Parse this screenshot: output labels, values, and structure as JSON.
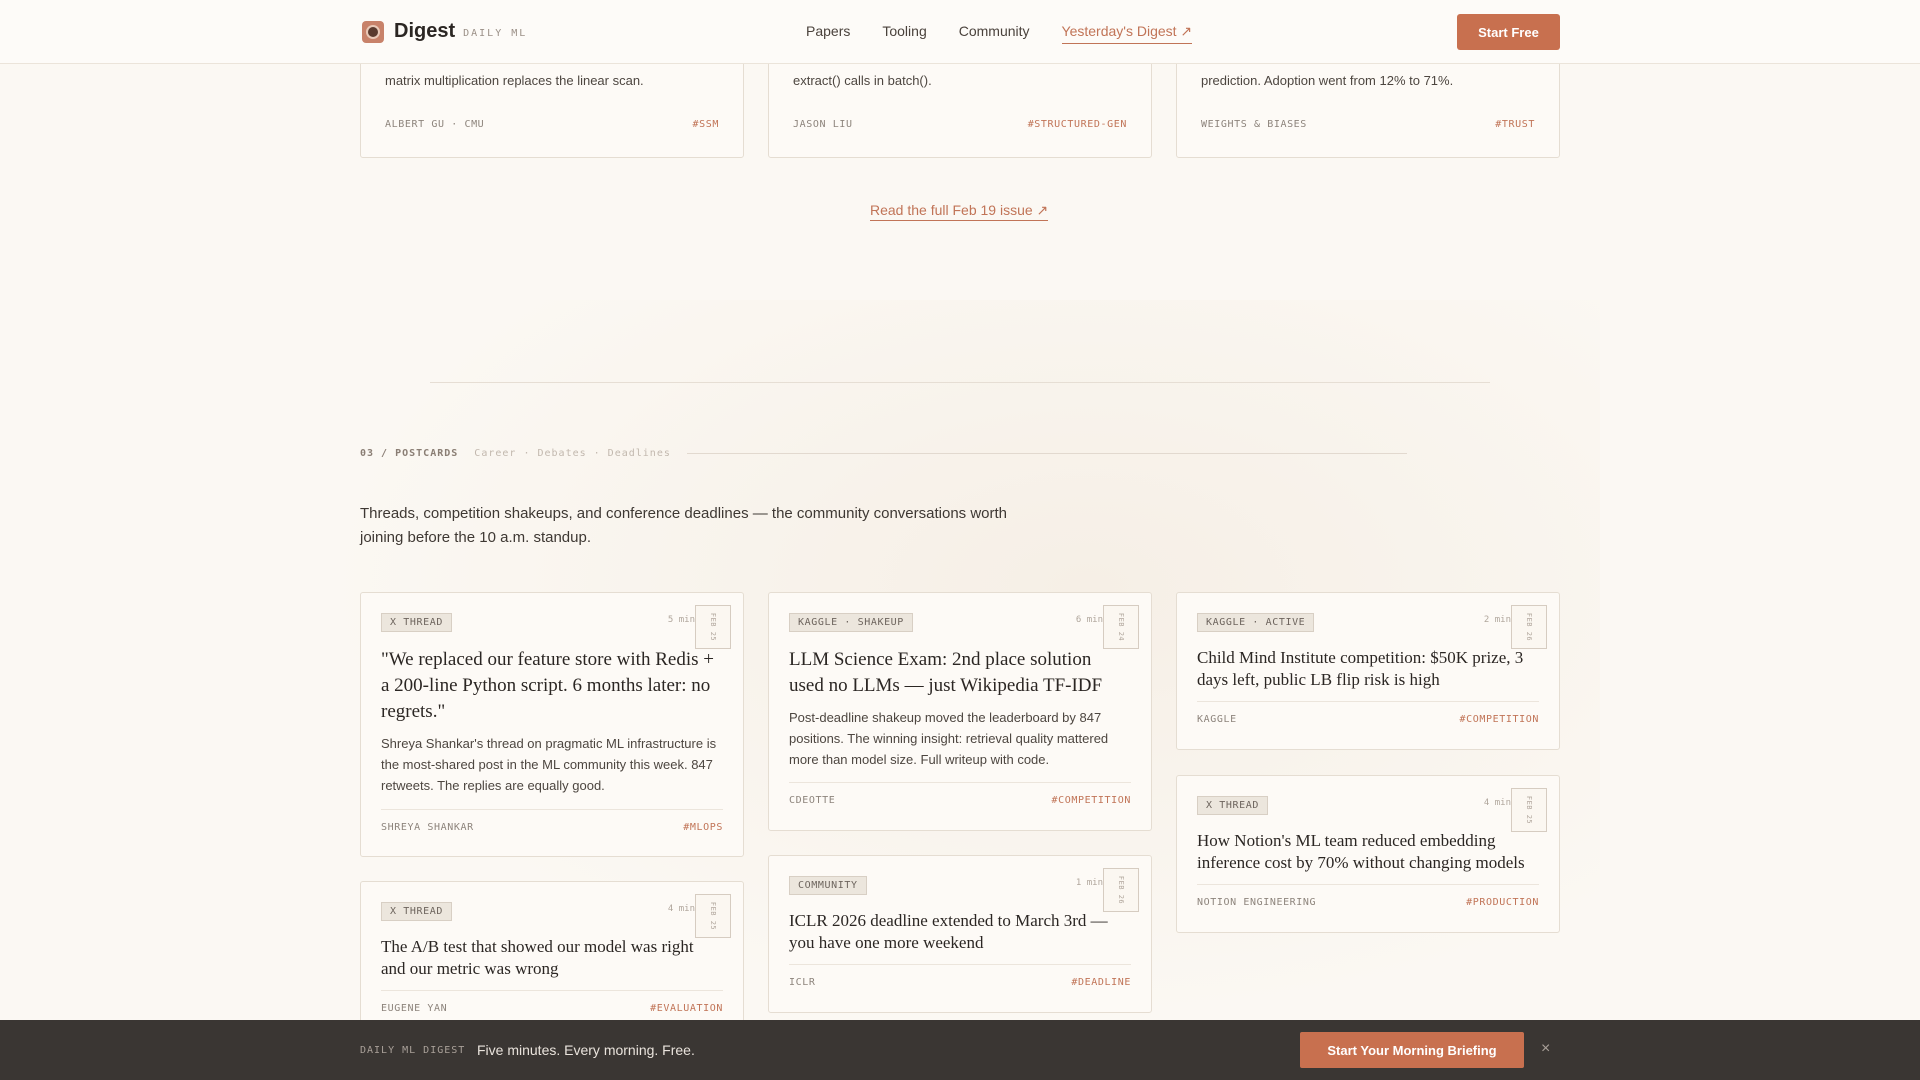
{
  "header": {
    "brand": "Digest",
    "brand_sub": "DAILY ML",
    "nav": [
      "Papers",
      "Tooling",
      "Community",
      "Yesterday's Digest ↗"
    ],
    "cta": "Start Free"
  },
  "top_cards": [
    {
      "excerpt": "matrix multiplication replaces the linear scan.",
      "author": "ALBERT GU · CMU",
      "tag": "#SSM"
    },
    {
      "excerpt": "extract() calls in batch().",
      "author": "JASON LIU",
      "tag": "#STRUCTURED-GEN"
    },
    {
      "excerpt": "prediction. Adoption went from 12% to 71%.",
      "author": "WEIGHTS & BIASES",
      "tag": "#TRUST"
    }
  ],
  "read_more": "Read the full Feb 19 issue ↗",
  "section": {
    "number": "03 / POSTCARDS",
    "topics": "Career · Debates · Deadlines",
    "intro": "Threads, competition shakeups, and conference deadlines — the community conversations worth joining before the 10 a.m. standup."
  },
  "postcards": [
    {
      "badge": "X THREAD",
      "min": "5 min",
      "stamp": "FEB 25",
      "title": "\"We replaced our feature store with Redis + a 200-line Python script. 6 months later: no regrets.\"",
      "desc": "Shreya Shankar's thread on pragmatic ML infrastructure is the most-shared post in the ML community this week. 847 retweets. The replies are equally good.",
      "author": "SHREYA SHANKAR",
      "tag": "#MLOPS"
    },
    {
      "badge": "KAGGLE · SHAKEUP",
      "min": "6 min",
      "stamp": "FEB 24",
      "title": "LLM Science Exam: 2nd place solution used no LLMs — just Wikipedia TF-IDF",
      "desc": "Post-deadline shakeup moved the leaderboard by 847 positions. The winning insight: retrieval quality mattered more than model size. Full writeup with code.",
      "author": "CDEOTTE",
      "tag": "#COMPETITION"
    },
    {
      "badge": "KAGGLE · ACTIVE",
      "min": "2 min",
      "stamp": "FEB 26",
      "title": "Child Mind Institute competition: $50K prize, 3 days left, public LB flip risk is high",
      "author": "KAGGLE",
      "tag": "#COMPETITION"
    },
    {
      "badge": "X THREAD",
      "min": "4 min",
      "stamp": "FEB 25",
      "title": "The A/B test that showed our model was right and our metric was wrong",
      "author": "EUGENE YAN",
      "tag": "#EVALUATION"
    },
    {
      "badge": "COMMUNITY",
      "min": "1 min",
      "stamp": "FEB 26",
      "title": "ICLR 2026 deadline extended to March 3rd — you have one more weekend",
      "author": "ICLR",
      "tag": "#DEADLINE"
    },
    {
      "badge": "X THREAD",
      "min": "4 min",
      "stamp": "FEB 25",
      "title": "How Notion's ML team reduced embedding inference cost by 70% without changing models",
      "author": "NOTION ENGINEERING",
      "tag": "#PRODUCTION"
    }
  ],
  "bottom_bar": {
    "label": "DAILY ML DIGEST",
    "text": "Five minutes. Every morning. Free.",
    "cta": "Start Your Morning Briefing",
    "close": "×"
  }
}
